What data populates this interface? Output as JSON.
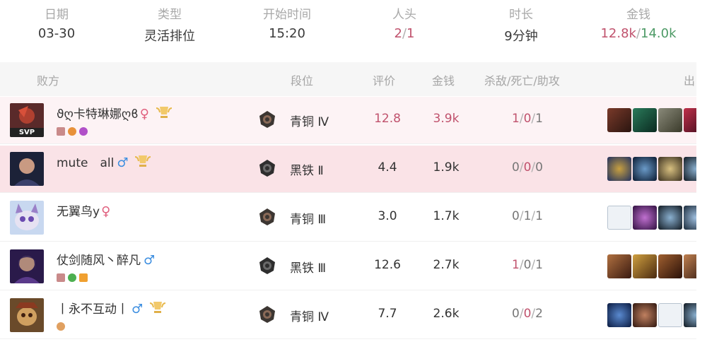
{
  "summary": [
    {
      "label": "日期",
      "value": "03-30"
    },
    {
      "label": "类型",
      "value": "灵活排位"
    },
    {
      "label": "开始时间",
      "value": "15:20"
    },
    {
      "label": "人头",
      "kills": "2",
      "deaths": "1"
    },
    {
      "label": "时长",
      "value": "9分钟"
    },
    {
      "label": "金钱",
      "gold_a": "12.8k",
      "gold_b": "14.0k"
    }
  ],
  "header": {
    "team": "败方",
    "rank": "段位",
    "score": "评价",
    "gold": "金钱",
    "kda": "杀敌/死亡/助攻",
    "items": "出"
  },
  "colors": {
    "loss_red": "#c0526d",
    "gold_green": "#4d9a66",
    "female": "#e0607e",
    "male": "#3c8ee0",
    "highlight_row": "#fae3e7"
  },
  "players": [
    {
      "name": "ϑღ卡特琳娜ღϐ",
      "gender": "♀",
      "svp": "SVP",
      "rank": "青铜 Ⅳ",
      "score": "12.8",
      "gold": "3.9k",
      "k": "1",
      "d": "0",
      "a": "1"
    },
    {
      "name": "mute　all",
      "gender": "♂",
      "rank": "黑铁 Ⅱ",
      "score": "4.4",
      "gold": "1.9k",
      "k": "0",
      "d": "0",
      "a": "0"
    },
    {
      "name": "无翼鸟y",
      "gender": "♀",
      "rank": "青铜 Ⅲ",
      "score": "3.0",
      "gold": "1.7k",
      "k": "0",
      "d": "1",
      "a": "1"
    },
    {
      "name": "仗剑随风丶醉凡",
      "gender": "♂",
      "rank": "黑铁 Ⅲ",
      "score": "12.6",
      "gold": "2.7k",
      "k": "1",
      "d": "0",
      "a": "1"
    },
    {
      "name": "丨永不互动丨",
      "gender": "♂",
      "rank": "青铜 Ⅳ",
      "score": "7.7",
      "gold": "2.6k",
      "k": "0",
      "d": "0",
      "a": "2"
    }
  ]
}
